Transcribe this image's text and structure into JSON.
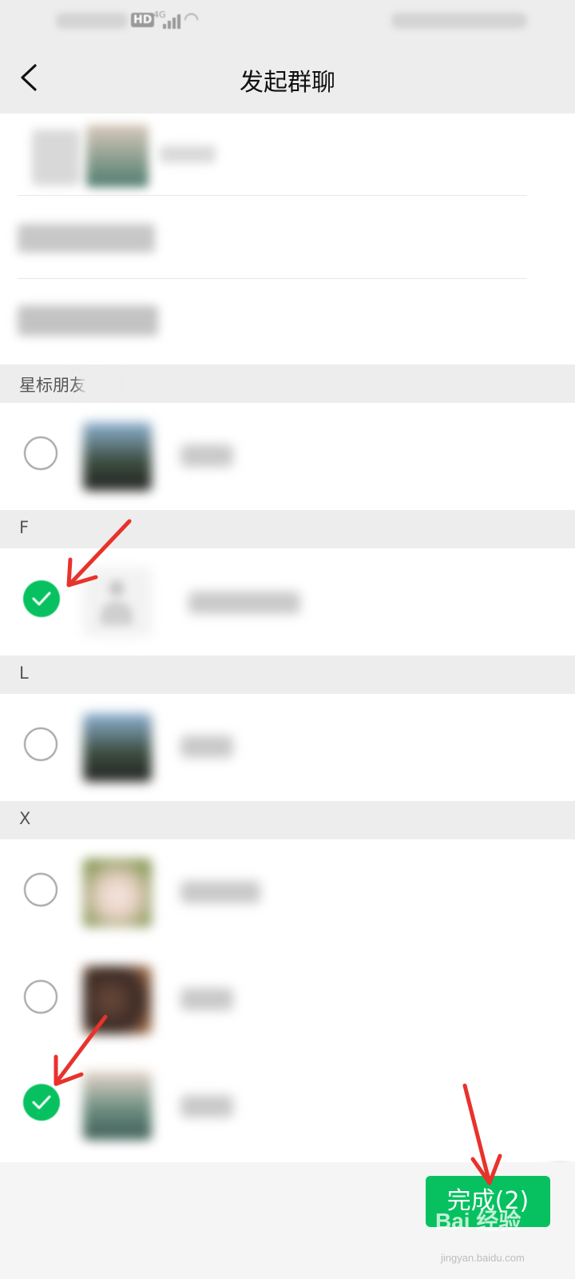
{
  "header": {
    "title": "发起群聊",
    "back_icon": "chevron-left-icon"
  },
  "status_bar": {
    "hd_badge": "HD",
    "network": "4G"
  },
  "sections": {
    "starred_label": "星标朋友",
    "f_label": "F",
    "l_label": "L",
    "x_label": "X"
  },
  "contacts": [
    {
      "section": "星标朋友",
      "checked": false
    },
    {
      "section": "F",
      "checked": true
    },
    {
      "section": "L",
      "checked": false
    },
    {
      "section": "X",
      "checked": false
    },
    {
      "section": "X",
      "checked": false
    },
    {
      "section": "X",
      "checked": true
    }
  ],
  "footer": {
    "done_label": "完成(2)"
  },
  "watermark": {
    "brand": "Bai 经验",
    "url": "jingyan.baidu.com"
  },
  "colors": {
    "accent_green": "#07c160",
    "annotation_red": "#e8322b",
    "background": "#ededed"
  }
}
